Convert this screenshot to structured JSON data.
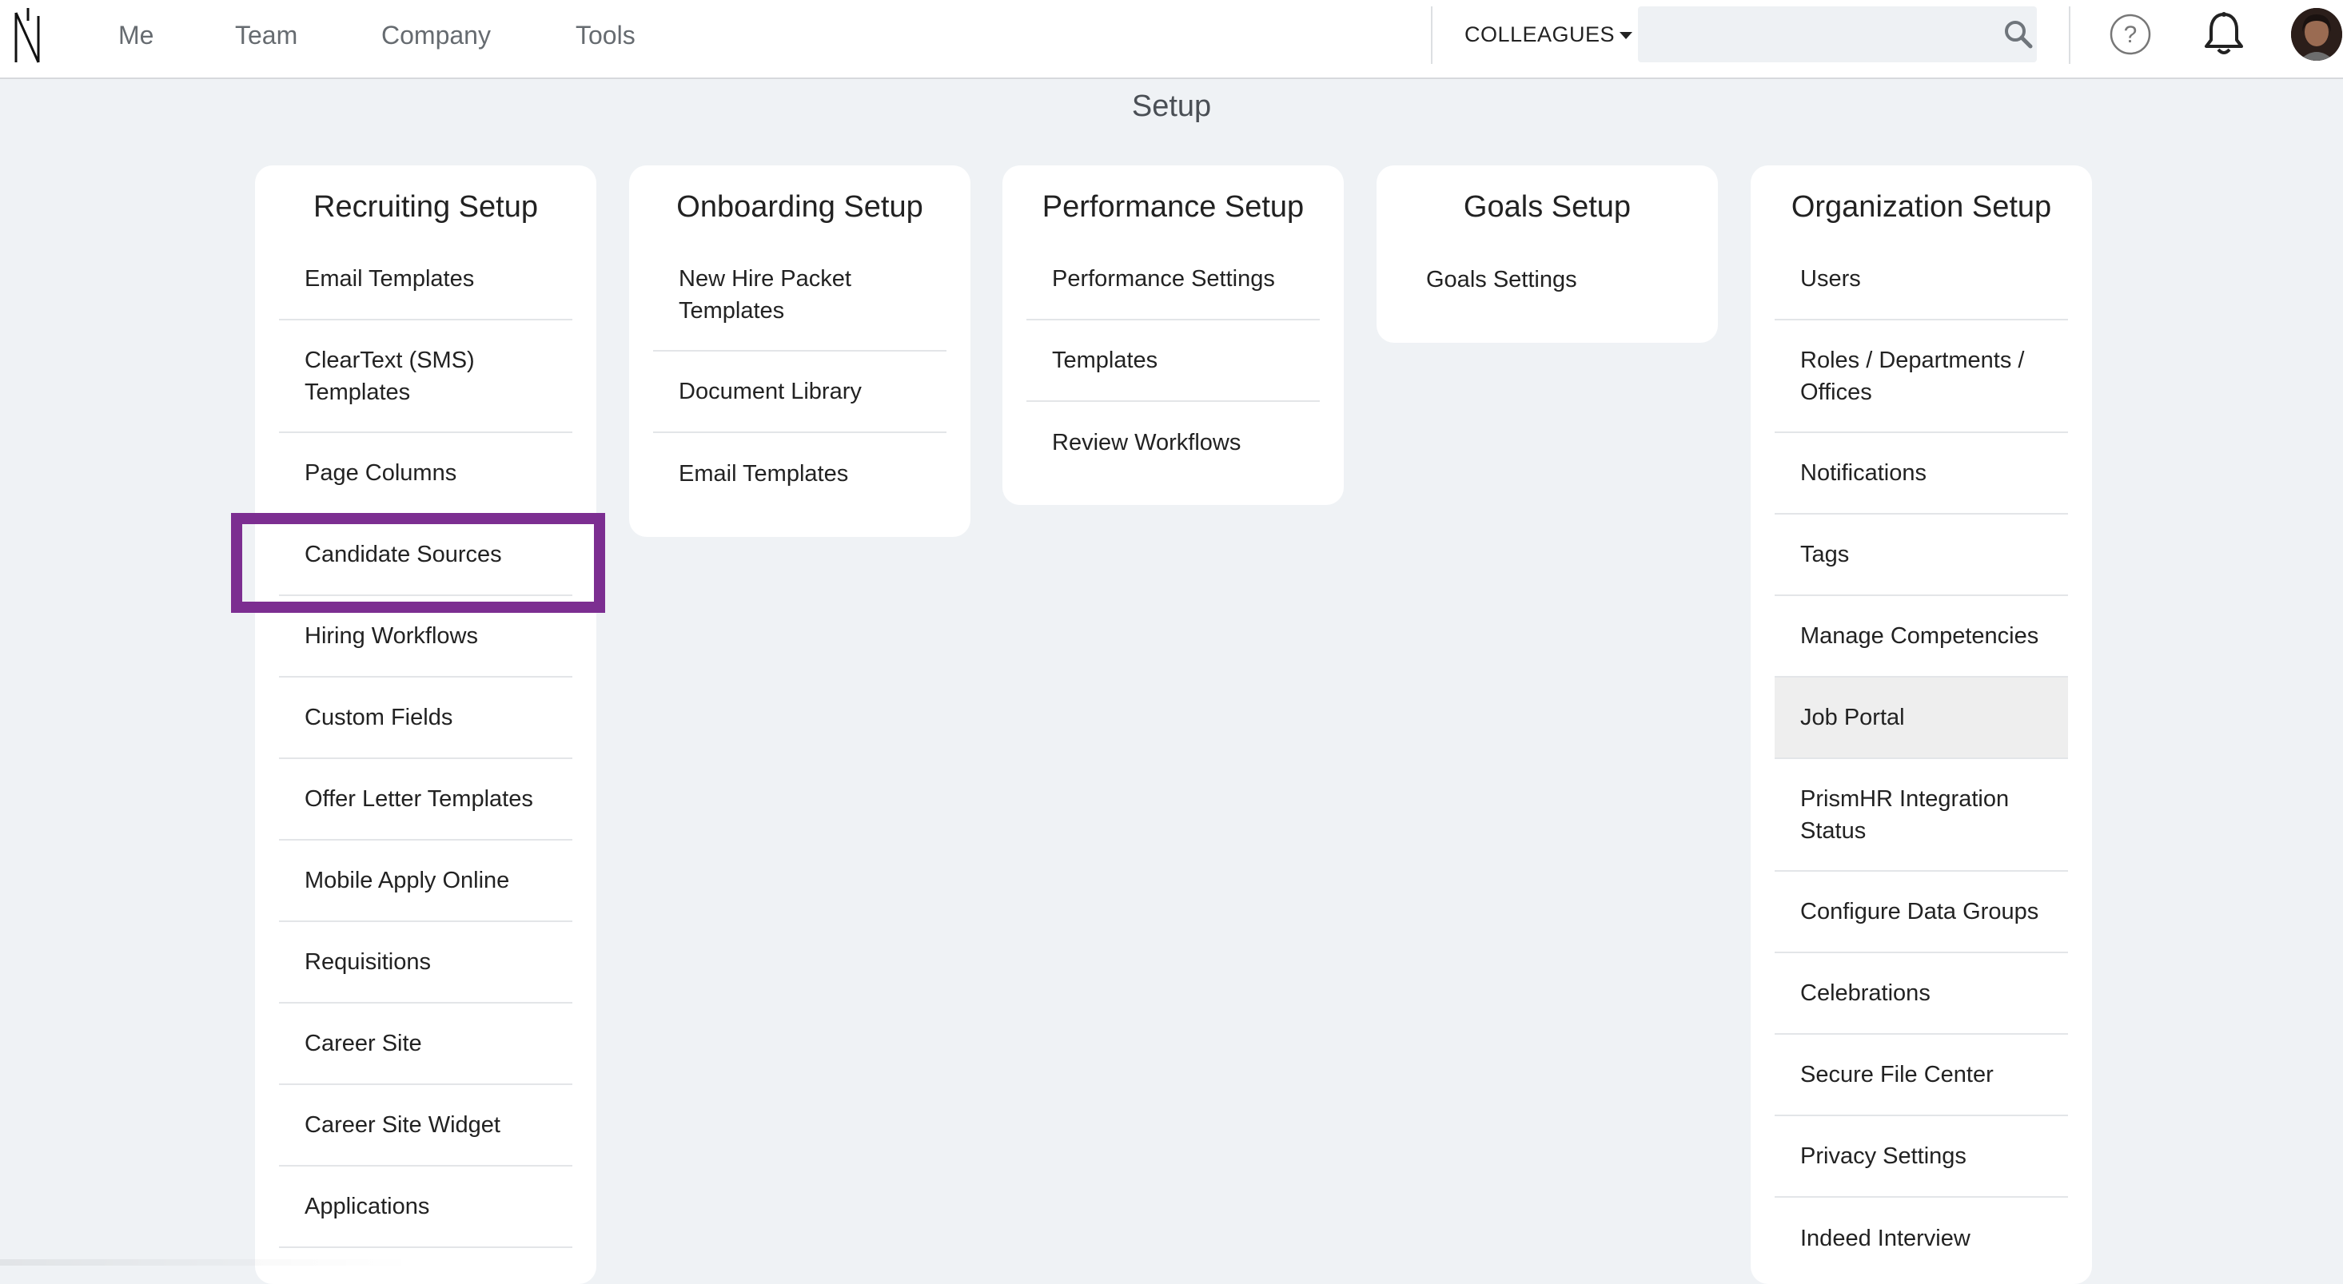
{
  "nav": {
    "items": [
      {
        "label": "Me"
      },
      {
        "label": "Team"
      },
      {
        "label": "Company"
      },
      {
        "label": "Tools"
      }
    ],
    "colleagues_label": "COLLEAGUES",
    "search": {
      "value": "",
      "placeholder": ""
    },
    "icons": [
      "logo-n-icon",
      "search-icon",
      "help-icon",
      "bell-icon",
      "avatar"
    ]
  },
  "page": {
    "title": "Setup"
  },
  "cards": [
    {
      "title": "Recruiting Setup",
      "items": [
        {
          "label": "Email Templates"
        },
        {
          "label": "ClearText (SMS) Templates"
        },
        {
          "label": "Page Columns"
        },
        {
          "label": "Candidate Sources",
          "highlighted": true
        },
        {
          "label": "Hiring Workflows"
        },
        {
          "label": "Custom Fields"
        },
        {
          "label": "Offer Letter Templates"
        },
        {
          "label": "Mobile Apply Online"
        },
        {
          "label": "Requisitions"
        },
        {
          "label": "Career Site"
        },
        {
          "label": "Career Site Widget"
        },
        {
          "label": "Applications"
        }
      ]
    },
    {
      "title": "Onboarding Setup",
      "items": [
        {
          "label": "New Hire Packet Templates"
        },
        {
          "label": "Document Library"
        },
        {
          "label": "Email Templates"
        }
      ]
    },
    {
      "title": "Performance Setup",
      "items": [
        {
          "label": "Performance Settings"
        },
        {
          "label": "Templates"
        },
        {
          "label": "Review Workflows"
        }
      ]
    },
    {
      "title": "Goals Setup",
      "items": [
        {
          "label": "Goals Settings"
        }
      ]
    },
    {
      "title": "Organization Setup",
      "items": [
        {
          "label": "Users"
        },
        {
          "label": "Roles / Departments / Offices"
        },
        {
          "label": "Notifications"
        },
        {
          "label": "Tags"
        },
        {
          "label": "Manage Competencies"
        },
        {
          "label": "Job Portal",
          "hovered": true
        },
        {
          "label": "PrismHR Integration Status"
        },
        {
          "label": "Configure Data Groups"
        },
        {
          "label": "Celebrations"
        },
        {
          "label": "Secure File Center"
        },
        {
          "label": "Privacy Settings"
        },
        {
          "label": "Indeed Interview"
        }
      ]
    }
  ],
  "colors": {
    "background": "#eff2f5",
    "card": "#ffffff",
    "highlight_border": "#7c2e91",
    "hover_row": "#eeeeee"
  }
}
